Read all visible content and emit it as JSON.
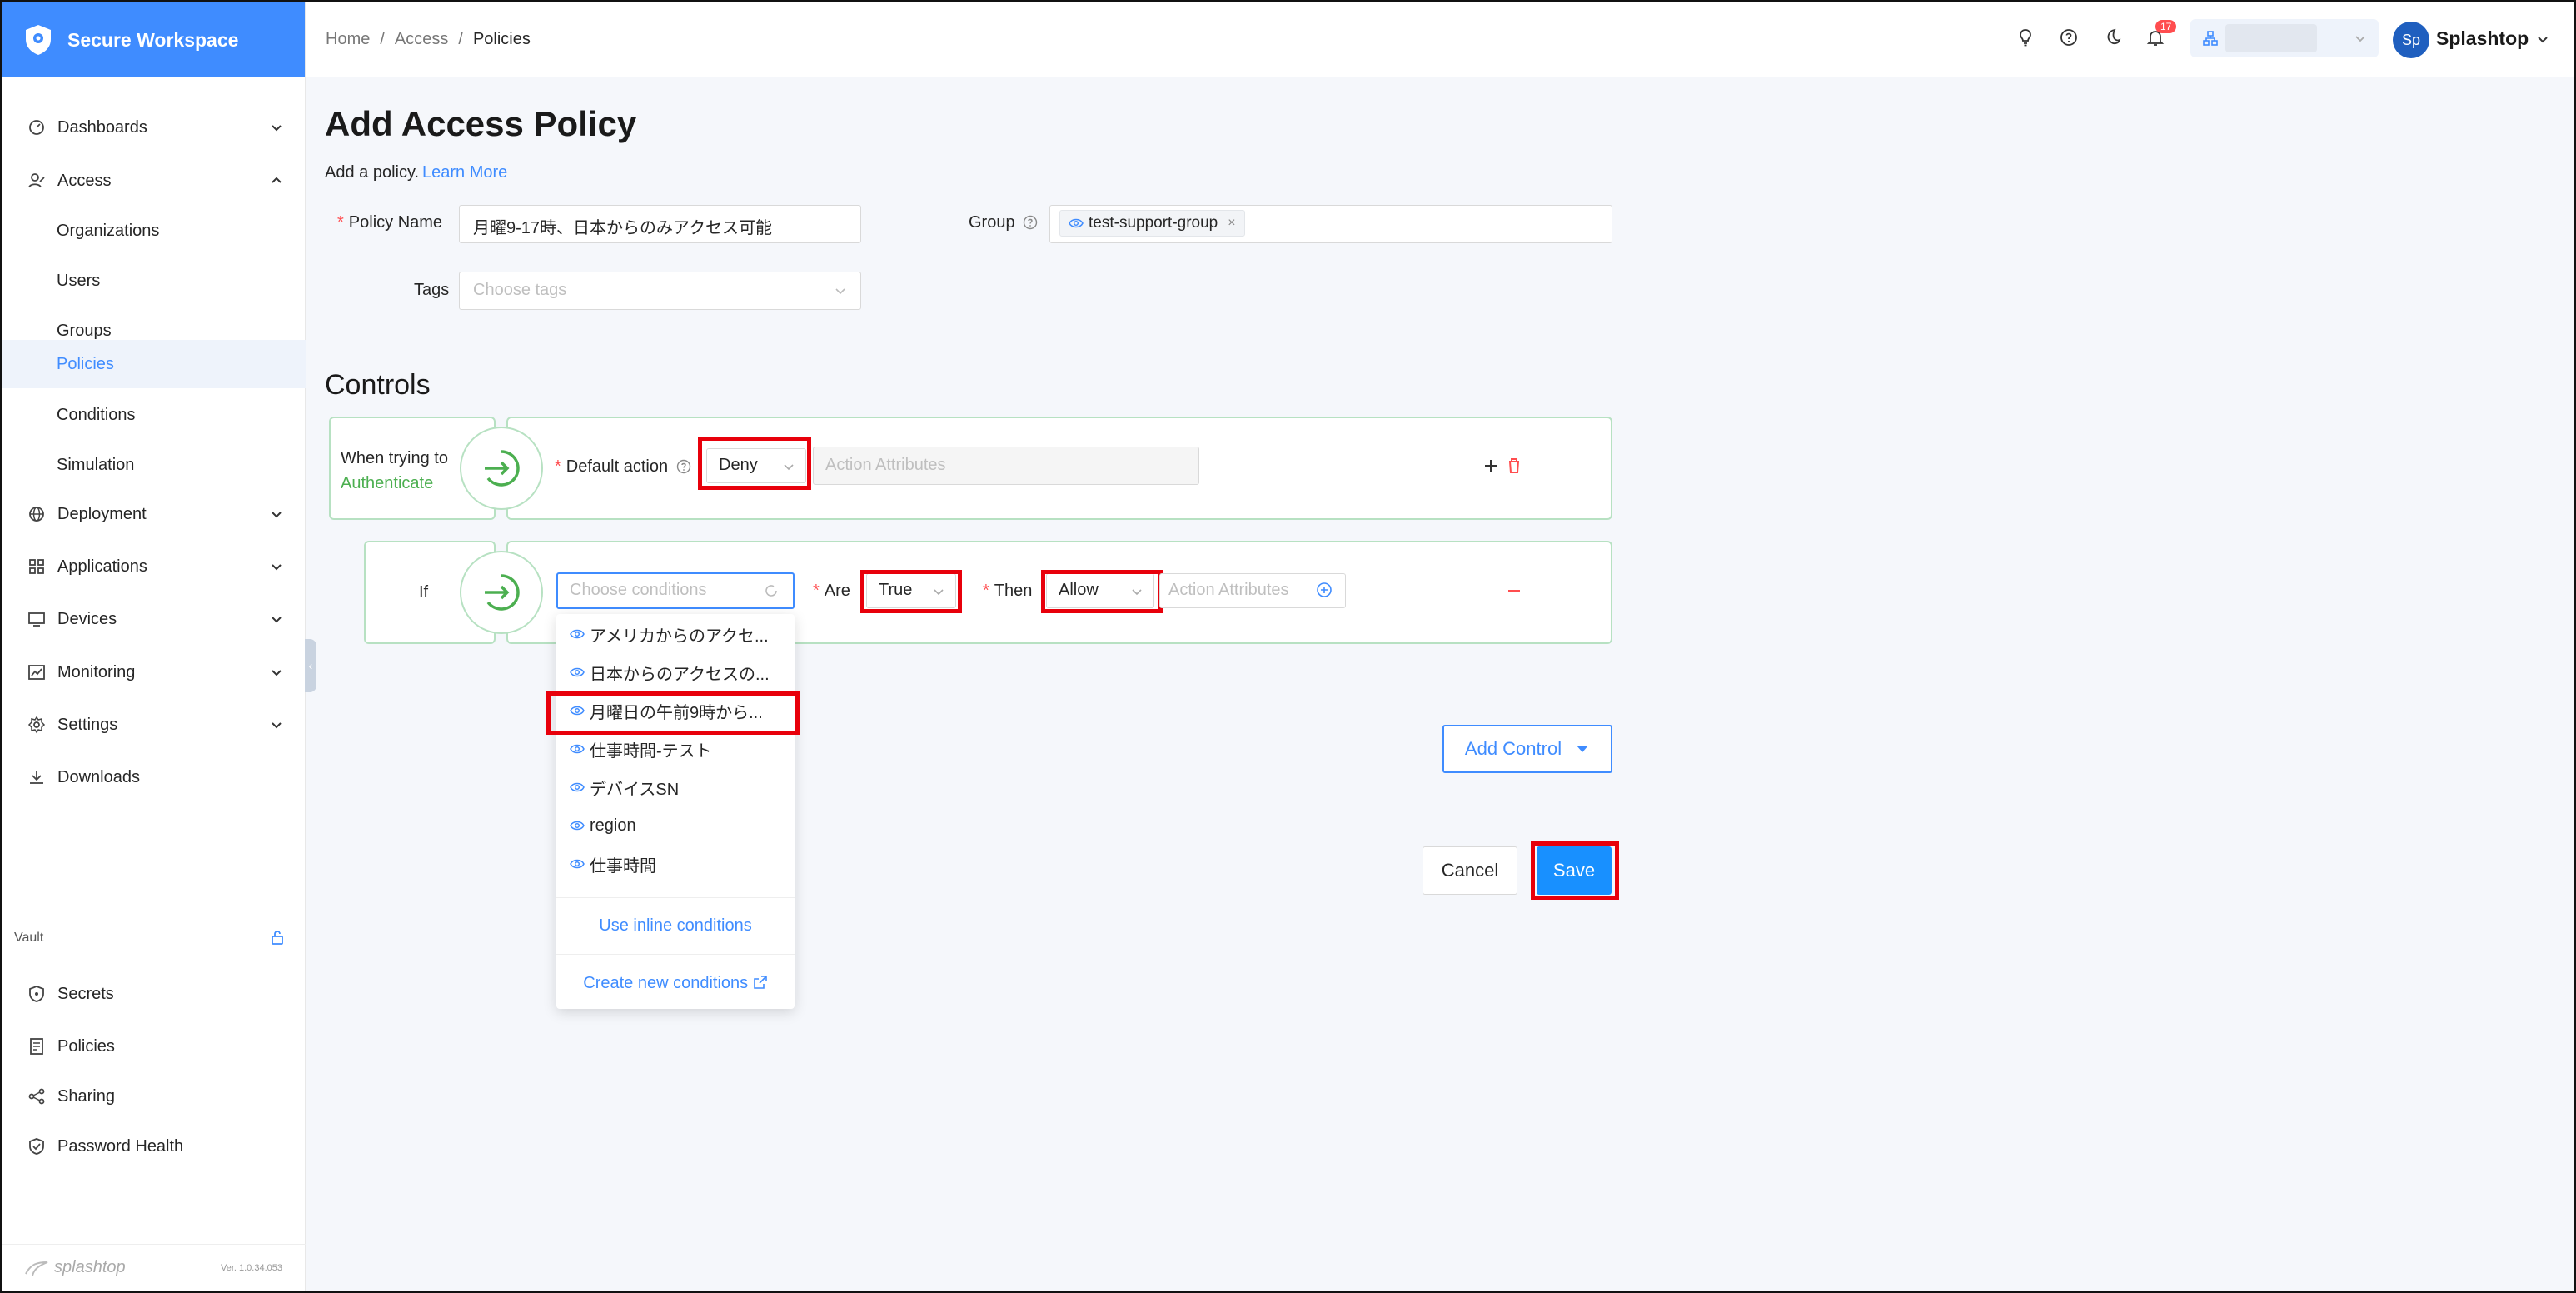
{
  "brand": {
    "name": "Secure Workspace"
  },
  "breadcrumb": {
    "items": [
      "Home",
      "Access",
      "Policies"
    ],
    "sep": "/"
  },
  "topbar": {
    "notifications_count": "17",
    "user_initials": "Sp",
    "user_name": "Splashtop"
  },
  "sidebar": {
    "items": [
      {
        "label": "Dashboards",
        "icon": "dashboard-icon"
      },
      {
        "label": "Access",
        "icon": "access-icon"
      },
      {
        "label": "Deployment",
        "icon": "globe-icon"
      },
      {
        "label": "Applications",
        "icon": "apps-icon"
      },
      {
        "label": "Devices",
        "icon": "monitor-icon"
      },
      {
        "label": "Monitoring",
        "icon": "chart-icon"
      },
      {
        "label": "Settings",
        "icon": "gear-icon"
      },
      {
        "label": "Downloads",
        "icon": "download-icon"
      }
    ],
    "access_sub": [
      "Organizations",
      "Users",
      "Groups",
      "Policies",
      "Conditions",
      "Simulation"
    ],
    "vault_label": "Vault",
    "vault_items": [
      "Secrets",
      "Policies",
      "Sharing",
      "Password Health"
    ],
    "footer_logo": "splashtop",
    "version": "Ver. 1.0.34.053"
  },
  "page": {
    "title": "Add Access Policy",
    "subtitle": "Add a policy.",
    "learn_more": "Learn More"
  },
  "form": {
    "policy_name_label": "Policy Name",
    "policy_name_value": "月曜9-17時、日本からのみアクセス可能",
    "group_label": "Group",
    "group_chip": "test-support-group",
    "tags_label": "Tags",
    "tags_placeholder": "Choose tags"
  },
  "controls": {
    "title": "Controls",
    "when_trying_to": "When trying to",
    "authenticate": "Authenticate",
    "default_action_label": "Default action",
    "default_action_value": "Deny",
    "action_attributes_placeholder": "Action Attributes",
    "if_label": "If",
    "conditions_placeholder": "Choose conditions",
    "are_label": "Are",
    "are_value": "True",
    "then_label": "Then",
    "then_value": "Allow",
    "action_attributes_placeholder2": "Action Attributes",
    "add_control": "Add Control"
  },
  "dropdown": {
    "options": [
      "アメリカからのアクセ...",
      "日本からのアクセスの...",
      "月曜日の午前9時から...",
      "仕事時間-テスト",
      "デバイスSN",
      "region",
      "仕事時間"
    ],
    "use_inline": "Use inline conditions",
    "create_new": "Create new conditions"
  },
  "buttons": {
    "cancel": "Cancel",
    "save": "Save"
  },
  "colors": {
    "brand": "#3f8cff",
    "highlight": "#e8000b",
    "success": "#4caf50",
    "primary_button": "#1890ff"
  }
}
